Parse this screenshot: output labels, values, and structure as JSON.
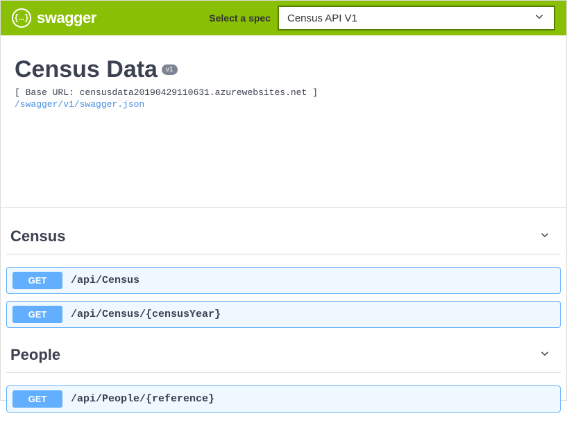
{
  "topbar": {
    "brand": "swagger",
    "spec_label": "Select a spec",
    "spec_selected": "Census API V1"
  },
  "info": {
    "title": "Census Data",
    "version": "v1",
    "base_url_prefix": "[ Base URL: ",
    "base_url": "censusdata20190429110631.azurewebsites.net",
    "base_url_suffix": " ]",
    "json_link": "/swagger/v1/swagger.json"
  },
  "tags": [
    {
      "name": "Census",
      "operations": [
        {
          "method": "GET",
          "path": "/api/Census"
        },
        {
          "method": "GET",
          "path": "/api/Census/{censusYear}"
        }
      ]
    },
    {
      "name": "People",
      "operations": [
        {
          "method": "GET",
          "path": "/api/People/{reference}"
        }
      ]
    }
  ]
}
